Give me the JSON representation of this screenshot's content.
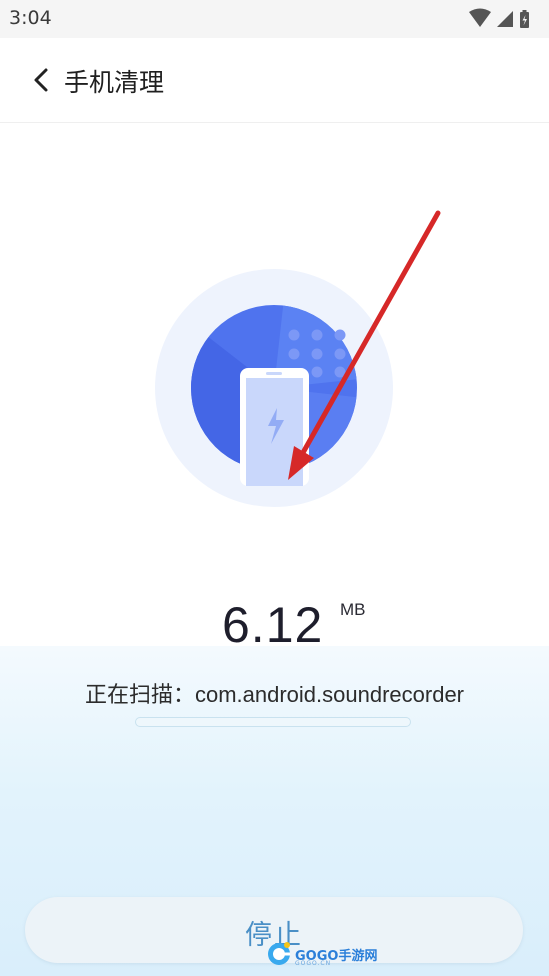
{
  "status_bar": {
    "time": "3:04"
  },
  "header": {
    "title": "手机清理"
  },
  "scan": {
    "size_value": "6.12",
    "size_unit": "MB",
    "scanning_text": "正在扫描：com.android.soundrecorder",
    "progress_fraction": 0
  },
  "actions": {
    "stop_label": "停止"
  },
  "watermark": {
    "brand": "GOGO手游网",
    "domain": "GOGO.CN"
  },
  "colors": {
    "accent_blue": "#4a6ff0",
    "arrow_red": "#d62828",
    "button_text": "#4a8fc6"
  }
}
